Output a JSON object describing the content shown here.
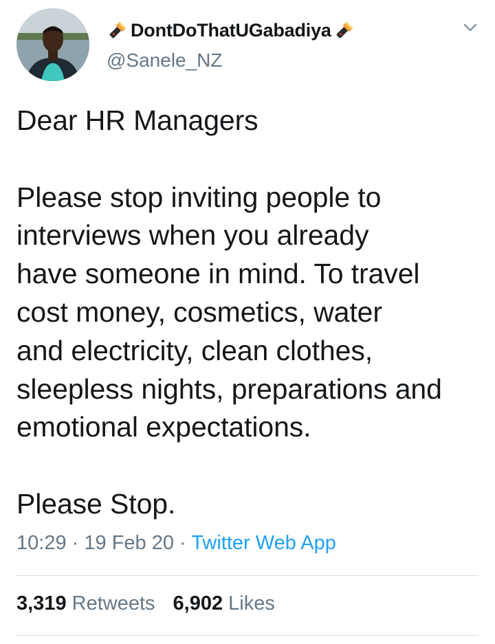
{
  "user": {
    "display_name": "DontDoThatUGabadiya",
    "handle": "@Sanele_NZ",
    "name_emoji": "flashlight-icon"
  },
  "tweet": {
    "lines": [
      "Dear HR Managers",
      "",
      "Please stop inviting people to",
      "interviews when you already",
      "have someone in mind. To travel",
      "cost money, cosmetics, water",
      "and electricity, clean clothes,",
      "sleepless nights, preparations and",
      "emotional expectations.",
      "",
      "Please Stop."
    ],
    "time": "10:29",
    "date": "19 Feb 20",
    "separator": "·",
    "source": "Twitter Web App"
  },
  "stats": {
    "retweets_count": "3,319",
    "retweets_label": "Retweets",
    "likes_count": "6,902",
    "likes_label": "Likes"
  },
  "colors": {
    "text": "#14171a",
    "secondary": "#657786",
    "link": "#1da1f2",
    "divider": "#d8dde2"
  }
}
